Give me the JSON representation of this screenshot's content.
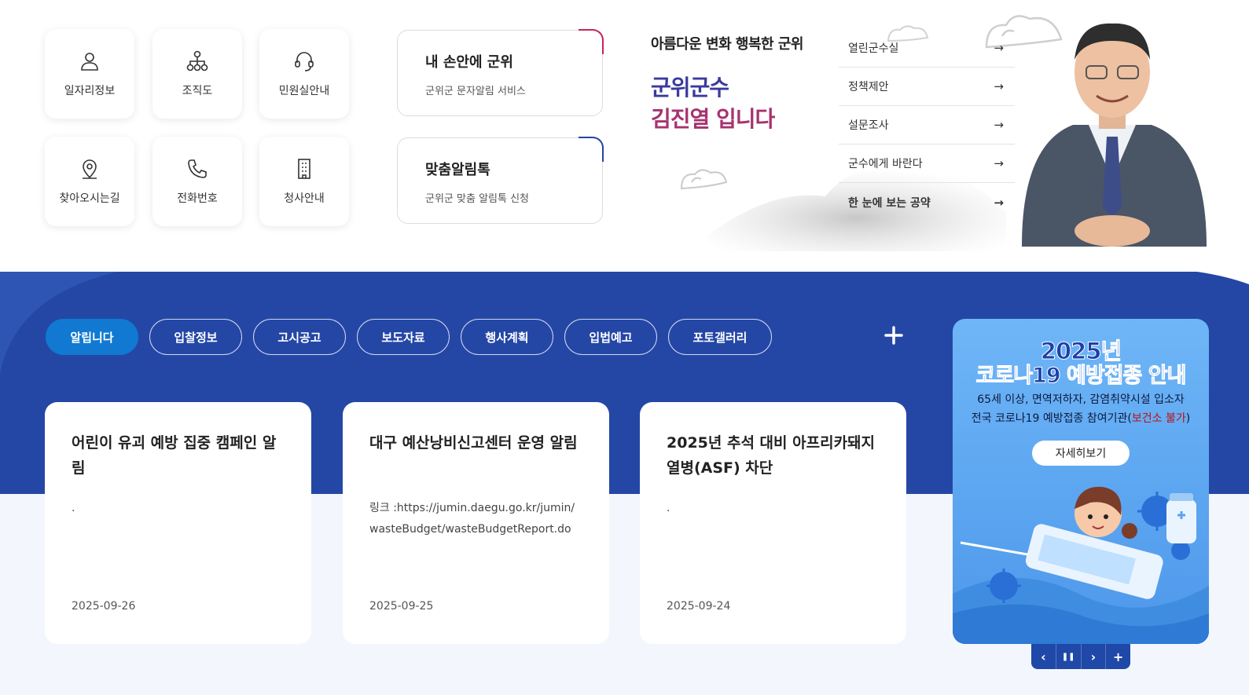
{
  "quick_links": [
    {
      "label": "일자리정보",
      "icon": "person-icon"
    },
    {
      "label": "조직도",
      "icon": "org-chart-icon"
    },
    {
      "label": "민원실안내",
      "icon": "headset-icon"
    },
    {
      "label": "찾아오시는길",
      "icon": "location-pin-icon"
    },
    {
      "label": "전화번호",
      "icon": "phone-icon"
    },
    {
      "label": "청사안내",
      "icon": "building-icon"
    }
  ],
  "alerts": [
    {
      "title": "내 손안에 군위",
      "subtitle": "군위군 문자알림 서비스",
      "accent": "#c8245c"
    },
    {
      "title": "맞춤알림톡",
      "subtitle": "군위군 맞춤 알림톡 신청",
      "accent": "#2447a6"
    }
  ],
  "governor": {
    "slogan": "아름다운 변화 행복한 군위",
    "name_line1": "군위군수",
    "name_line2": "김진열 입니다",
    "links": [
      "열린군수실",
      "정책제안",
      "설문조사",
      "군수에게 바란다",
      "한 눈에 보는 공약"
    ],
    "arrow": "→"
  },
  "tabs": [
    "알립니다",
    "입찰정보",
    "고시공고",
    "보도자료",
    "행사계획",
    "입법예고",
    "포토갤러리"
  ],
  "plus_icon": "plus-icon",
  "news": [
    {
      "title": "어린이 유괴 예방 집중 캠페인 알림",
      "body": ".",
      "date": "2025-09-26"
    },
    {
      "title": "대구 예산낭비신고센터 운영 알림",
      "body": "링크 :https://jumin.daegu.go.kr/jumin/wasteBudget/wasteBudgetReport.do",
      "date": "2025-09-25"
    },
    {
      "title": "2025년 추석 대비 아프리카돼지열병(ASF) 차단",
      "body": ".",
      "date": "2025-09-24"
    }
  ],
  "banner": {
    "line1": "2025년",
    "line2": "코로나19 예방접종 안내",
    "line3": "65세 이상, 면역저하자, 감염취약시설 입소자",
    "line4a": "전국 코로나19 예방접종 참여기관(",
    "line4b": "보건소 불가",
    "line4c": ")",
    "more": "자세히보기"
  },
  "banner_controls": {
    "prev": "‹",
    "pause": "❚❚",
    "next": "›",
    "more": "+"
  },
  "colors": {
    "primary": "#2447a6",
    "active_tab": "#1179d1",
    "accent_red": "#c8245c"
  }
}
